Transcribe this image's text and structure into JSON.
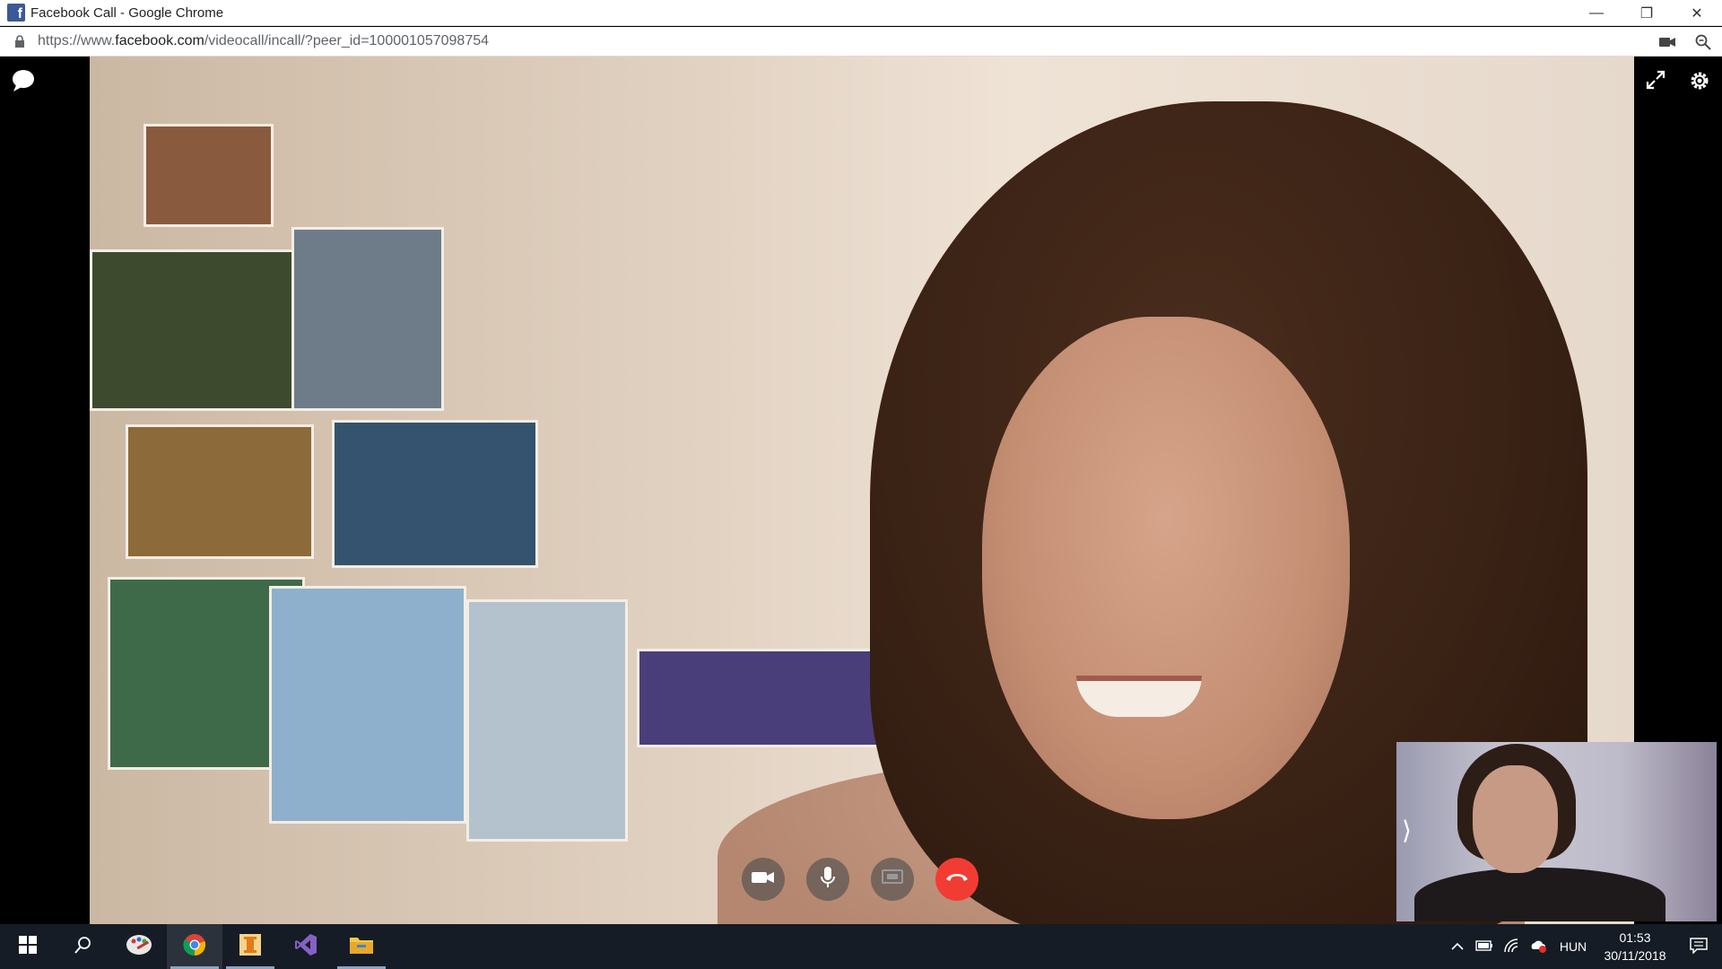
{
  "browser": {
    "window_title": "Facebook Call - Google Chrome",
    "favicon_letter": "f",
    "url_prefix": "https://www.",
    "url_host": "facebook.com",
    "url_path": "/videocall/incall/?peer_id=100001057098754"
  },
  "window_controls": {
    "minimize": "—",
    "restore": "❐",
    "close": "✕"
  },
  "call": {
    "controls": [
      "video-camera",
      "microphone",
      "screen-share",
      "end-call"
    ],
    "end_call_color": "#f23c33",
    "self_view_toggle": "⟩"
  },
  "taskbar": {
    "apps": [
      "start",
      "search",
      "paint",
      "chrome",
      "installer",
      "visual-studio",
      "file-explorer"
    ],
    "active_app": "chrome",
    "language": "HUN",
    "time": "01:53",
    "date": "30/11/2018"
  },
  "colors": {
    "taskbar_bg": "#151c25",
    "facebook_blue": "#3b5998"
  }
}
